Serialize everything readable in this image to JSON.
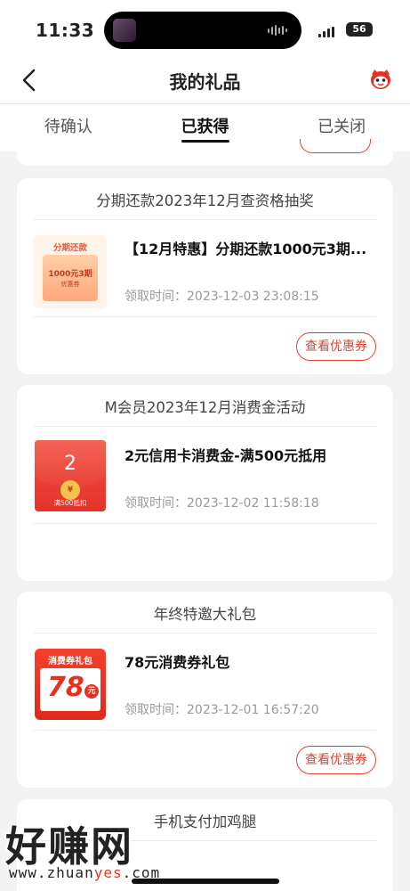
{
  "status_bar": {
    "time": "11:33",
    "battery": "56"
  },
  "nav": {
    "title": "我的礼品"
  },
  "tabs": [
    "待确认",
    "已获得",
    "已关闭"
  ],
  "cards": [
    {
      "title": "分期还款2023年12月查资格抽奖",
      "name": "【12月特惠】分期还款1000元3期...",
      "time": "领取时间：2023-12-03 23:08:15",
      "button": "查看优惠券",
      "thumb": {
        "title": "分期还款",
        "amount": "1000元3期",
        "sub": "优惠券"
      }
    },
    {
      "title": "M会员2023年12月消费金活动",
      "name": "2元信用卡消费金-满500元抵用",
      "time": "领取时间：2023-12-02 11:58:18",
      "thumb": {
        "amount": "2",
        "seal": "¥",
        "cond": "满500抵扣"
      }
    },
    {
      "title": "年终特邀大礼包",
      "name": "78元消费券礼包",
      "time": "领取时间：2023-12-01 16:57:20",
      "button": "查看优惠券",
      "thumb": {
        "tag": "消费券礼包",
        "amount": "78",
        "unit": "元"
      }
    },
    {
      "title": "手机支付加鸡腿"
    }
  ],
  "watermark": {
    "text": "好赚网",
    "url_pre": "www.zhuan",
    "url_hl": "yes",
    "url_post": ".com"
  },
  "colors": {
    "accent": "#e0442f",
    "background": "#f3f3f3"
  }
}
